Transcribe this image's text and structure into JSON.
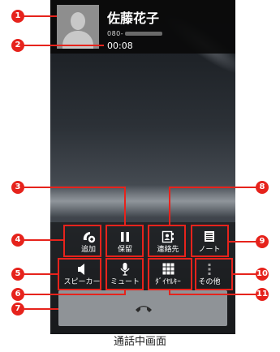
{
  "caller": {
    "name": "佐藤花子",
    "number_prefix": "080-",
    "timer": "00:08"
  },
  "buttons": [
    {
      "label": "追加",
      "icon": "add-call-icon"
    },
    {
      "label": "保留",
      "icon": "pause-icon"
    },
    {
      "label": "連絡先",
      "icon": "contacts-icon"
    },
    {
      "label": "ノート",
      "icon": "note-icon"
    },
    {
      "label": "スピーカー",
      "icon": "speaker-icon"
    },
    {
      "label": "ミュート",
      "icon": "microphone-icon"
    },
    {
      "label": "ﾀﾞｲﾔﾙｷｰ",
      "icon": "dialpad-icon"
    },
    {
      "label": "その他",
      "icon": "more-icon"
    }
  ],
  "end_call": {
    "icon": "end-call-icon"
  },
  "callouts": [
    "1",
    "2",
    "3",
    "4",
    "5",
    "6",
    "7",
    "8",
    "9",
    "10",
    "11"
  ],
  "caption": "通話中画面",
  "colors": {
    "callout": "#e6231c"
  }
}
